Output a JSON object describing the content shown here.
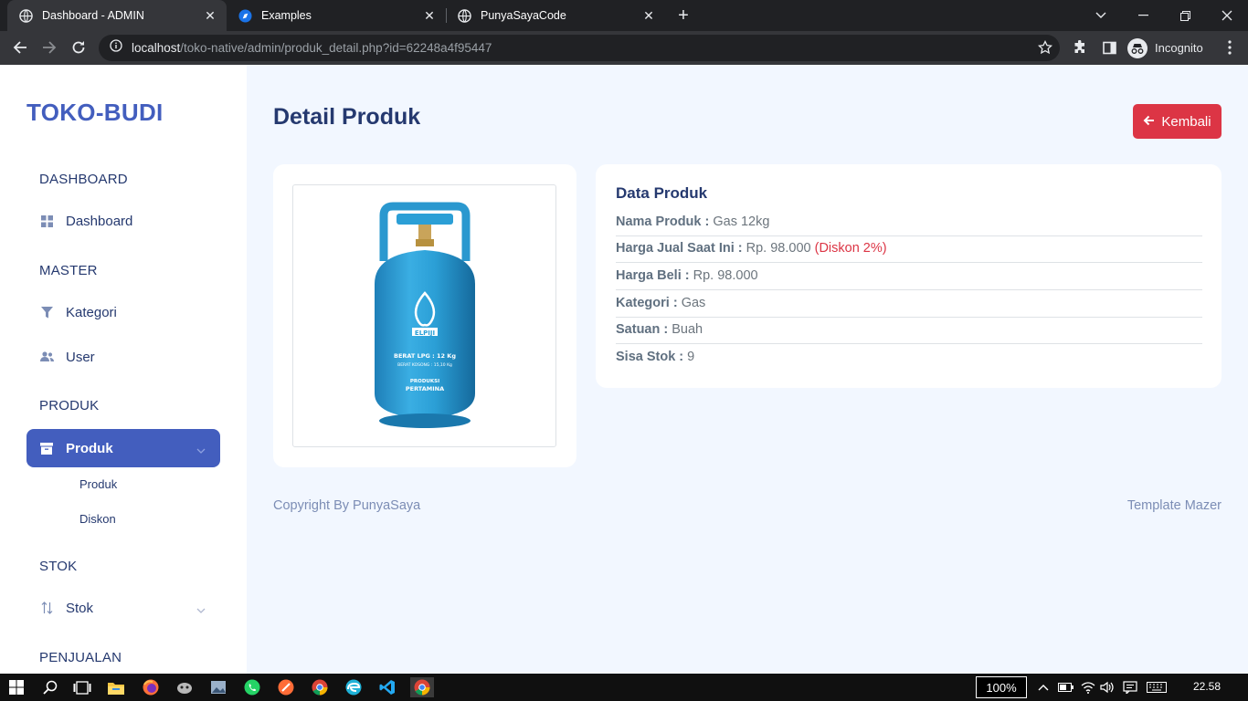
{
  "browser": {
    "tabs": [
      {
        "title": "Dashboard - ADMIN",
        "active": true
      },
      {
        "title": "Examples",
        "active": false
      },
      {
        "title": "PunyaSayaCode",
        "active": false
      }
    ],
    "url_host": "localhost",
    "url_path": "/toko-native/admin/produk_detail.php?id=62248a4f95447",
    "profile_label": "Incognito"
  },
  "sidebar": {
    "brand": "TOKO-BUDI",
    "sections": {
      "dashboard_title": "DASHBOARD",
      "master_title": "MASTER",
      "produk_title": "PRODUK",
      "stok_title": "STOK",
      "penjualan_title": "PENJUALAN"
    },
    "items": {
      "dashboard": "Dashboard",
      "kategori": "Kategori",
      "user": "User",
      "produk": "Produk",
      "stok": "Stok"
    },
    "submenu": {
      "produk": "Produk",
      "diskon": "Diskon"
    }
  },
  "main": {
    "page_title": "Detail Produk",
    "back_button": "Kembali",
    "data_card": {
      "title": "Data Produk",
      "rows": [
        {
          "label": "Nama Produk :",
          "value": "Gas 12kg"
        },
        {
          "label": "Harga Jual Saat Ini :",
          "value": "Rp. 98.000",
          "note": "(Diskon 2%)"
        },
        {
          "label": "Harga Beli :",
          "value": "Rp. 98.000"
        },
        {
          "label": "Kategori :",
          "value": "Gas"
        },
        {
          "label": "Satuan :",
          "value": "Buah"
        },
        {
          "label": "Sisa Stok :",
          "value": "9"
        }
      ]
    },
    "product_image": {
      "brand_text": "ELPIJI",
      "weight_text": "BERAT LPG : 12 Kg",
      "tare_text": "BERAT KOSONG : 15,10 Kg",
      "maker_text_1": "PRODUKSI",
      "maker_text_2": "PERTAMINA"
    }
  },
  "footer": {
    "left": "Copyright By PunyaSaya",
    "right": "Template Mazer"
  },
  "taskbar": {
    "zoom": "100%",
    "time": "22.58"
  },
  "colors": {
    "primary": "#435ebe",
    "danger": "#dc3545",
    "page_bg": "#f2f7ff",
    "heading": "#25396f"
  }
}
